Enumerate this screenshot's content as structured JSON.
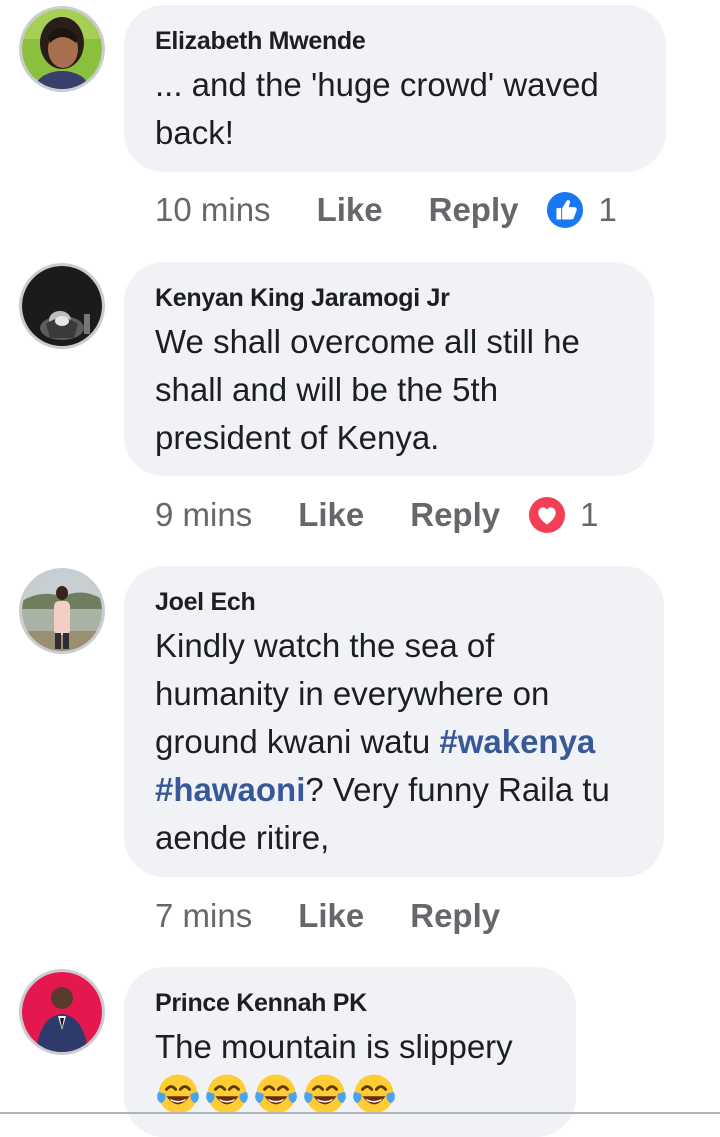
{
  "comments": [
    {
      "author": "Elizabeth Mwende",
      "lines": [
        "... and the 'huge crowd' waved",
        "back!"
      ],
      "time": "10 mins",
      "like_label": "Like",
      "reply_label": "Reply",
      "reaction": "like",
      "reaction_count": "1"
    },
    {
      "author": "Kenyan King Jaramogi Jr",
      "lines": [
        "We shall overcome all still he",
        "shall and will be the 5th",
        "president of Kenya."
      ],
      "time": "9 mins",
      "like_label": "Like",
      "reply_label": "Reply",
      "reaction": "love",
      "reaction_count": "1"
    },
    {
      "author": "Joel Ech",
      "line1": "Kindly watch the sea of",
      "line2": "humanity in everywhere on",
      "line3_pre": "ground kwani watu ",
      "hashtag1": "#wakenya",
      "hashtag2": "#hawaoni",
      "line4_post": "? Very funny Raila tu",
      "line5": "aende ritire,",
      "time": "7 mins",
      "like_label": "Like",
      "reply_label": "Reply"
    },
    {
      "author": "Prince Kennah PK",
      "lines": [
        "The mountain is slippery"
      ],
      "emoji": "face-with-tears-of-joy",
      "emoji_count": 5
    }
  ],
  "colors": {
    "bubble": "#f0f2f5",
    "hashtag": "#385898",
    "meta": "#65676b",
    "like_blue": "#1877f2",
    "love_red": "#f33e58"
  }
}
